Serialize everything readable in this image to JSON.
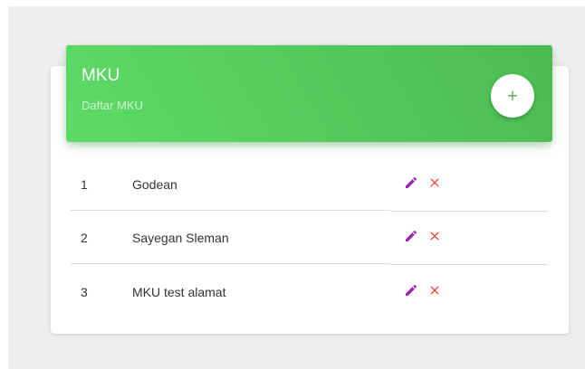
{
  "header": {
    "title": "MKU",
    "subtitle": "Daftar MKU",
    "add_button_symbol": "+",
    "add_icon": "plus-icon"
  },
  "colors": {
    "header_gradient_start": "#5ddb66",
    "header_gradient_end": "#4cbb52",
    "edit_icon": "#9c27b0",
    "delete_icon": "#f44336",
    "add_icon": "#4caf50"
  },
  "table": {
    "rows": [
      {
        "number": "1",
        "name": "Godean",
        "edit_icon": "pencil-icon",
        "delete_icon": "close-icon"
      },
      {
        "number": "2",
        "name": "Sayegan Sleman",
        "edit_icon": "pencil-icon",
        "delete_icon": "close-icon"
      },
      {
        "number": "3",
        "name": "MKU test alamat",
        "edit_icon": "pencil-icon",
        "delete_icon": "close-icon"
      }
    ]
  }
}
